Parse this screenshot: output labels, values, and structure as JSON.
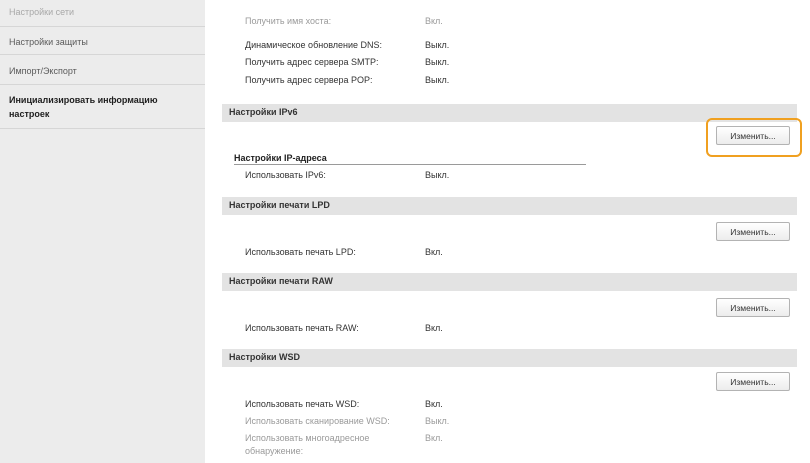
{
  "sidebar": {
    "items": [
      {
        "label": "Настройки сети",
        "state": "dim"
      },
      {
        "label": "Настройки защиты",
        "state": "normal"
      },
      {
        "label": "Импорт/Экспорт",
        "state": "normal"
      },
      {
        "label_line1": "Инициализировать информацию",
        "label_line2": "настроек",
        "state": "active"
      }
    ]
  },
  "dns_rows": [
    {
      "label": "Получить имя хоста:",
      "value": "Вкл."
    },
    {
      "label": "Динамическое обновление DNS:",
      "value": "Выкл."
    },
    {
      "label": "Получить адрес сервера SMTP:",
      "value": "Выкл."
    },
    {
      "label": "Получить адрес сервера POP:",
      "value": "Выкл."
    }
  ],
  "ipv6": {
    "section_title": "Настройки IPv6",
    "edit_label": "Изменить...",
    "subheading": "Настройки IP-адреса",
    "row_label": "Использовать IPv6:",
    "row_value": "Выкл."
  },
  "lpd": {
    "section_title": "Настройки печати LPD",
    "edit_label": "Изменить...",
    "row_label": "Использовать печать LPD:",
    "row_value": "Вкл."
  },
  "raw": {
    "section_title": "Настройки печати RAW",
    "edit_label": "Изменить...",
    "row_label": "Использовать печать RAW:",
    "row_value": "Вкл."
  },
  "wsd": {
    "section_title": "Настройки WSD",
    "edit_label": "Изменить...",
    "rows": [
      {
        "label": "Использовать печать WSD:",
        "value": "Вкл."
      },
      {
        "label": "Использовать сканирование WSD:",
        "value": "Выкл."
      },
      {
        "label": "Использовать многоадресное",
        "label2": "обнаружение:",
        "value": "Вкл."
      }
    ]
  },
  "colors": {
    "highlight": "#f0a020",
    "section_bg": "#e3e3e3",
    "sidebar_bg": "#ececec"
  }
}
